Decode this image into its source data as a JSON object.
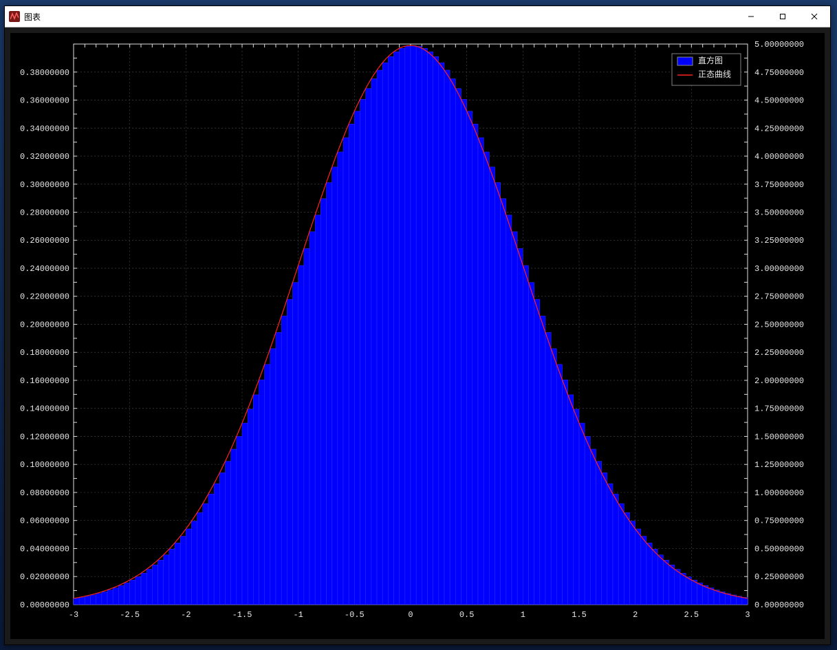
{
  "window": {
    "title": "图表",
    "controls": {
      "min": "—",
      "max": "☐",
      "close": "✕"
    }
  },
  "legend": {
    "items": [
      {
        "label": "直方图",
        "swatch": "#0000ff",
        "type": "box"
      },
      {
        "label": "正态曲线",
        "swatch": "#ff2020",
        "type": "line"
      }
    ]
  },
  "chart_data": {
    "type": "bar",
    "x_range": [
      -3,
      3
    ],
    "left_y_range": [
      0,
      0.4
    ],
    "right_y_range": [
      0,
      5.0
    ],
    "left_y_ticks": [
      0.0,
      0.02,
      0.04,
      0.06,
      0.08,
      0.1,
      0.12,
      0.14,
      0.16,
      0.18,
      0.2,
      0.22,
      0.24,
      0.26,
      0.28,
      0.3,
      0.32,
      0.34,
      0.36,
      0.38
    ],
    "right_y_ticks": [
      0.0,
      0.25,
      0.5,
      0.75,
      1.0,
      1.25,
      1.5,
      1.75,
      2.0,
      2.25,
      2.5,
      2.75,
      3.0,
      3.25,
      3.5,
      3.75,
      4.0,
      4.25,
      4.5,
      4.75,
      5.0
    ],
    "x_ticks_major": [
      -3,
      -2.5,
      -2,
      -1.5,
      -1,
      -0.5,
      0,
      0.5,
      1,
      1.5,
      2,
      2.5,
      3
    ],
    "series": [
      {
        "name": "直方图",
        "kind": "histogram",
        "axis": "left",
        "bin_width": 0.05,
        "x": [
          -3.0,
          -2.95,
          -2.9,
          -2.85,
          -2.8,
          -2.75,
          -2.7,
          -2.65,
          -2.6,
          -2.55,
          -2.5,
          -2.45,
          -2.4,
          -2.35,
          -2.3,
          -2.25,
          -2.2,
          -2.15,
          -2.1,
          -2.05,
          -2.0,
          -1.95,
          -1.9,
          -1.85,
          -1.8,
          -1.75,
          -1.7,
          -1.65,
          -1.6,
          -1.55,
          -1.5,
          -1.45,
          -1.4,
          -1.35,
          -1.3,
          -1.25,
          -1.2,
          -1.15,
          -1.1,
          -1.05,
          -1.0,
          -0.95,
          -0.9,
          -0.85,
          -0.8,
          -0.75,
          -0.7,
          -0.65,
          -0.6,
          -0.55,
          -0.5,
          -0.45,
          -0.4,
          -0.35,
          -0.3,
          -0.25,
          -0.2,
          -0.15,
          -0.1,
          -0.05,
          0.0,
          0.05,
          0.1,
          0.15,
          0.2,
          0.25,
          0.3,
          0.35,
          0.4,
          0.45,
          0.5,
          0.55,
          0.6,
          0.65,
          0.7,
          0.75,
          0.8,
          0.85,
          0.9,
          0.95,
          1.0,
          1.05,
          1.1,
          1.15,
          1.2,
          1.25,
          1.3,
          1.35,
          1.4,
          1.45,
          1.5,
          1.55,
          1.6,
          1.65,
          1.7,
          1.75,
          1.8,
          1.85,
          1.9,
          1.95,
          2.0,
          2.05,
          2.1,
          2.15,
          2.2,
          2.25,
          2.3,
          2.35,
          2.4,
          2.45,
          2.5,
          2.55,
          2.6,
          2.65,
          2.7,
          2.75,
          2.8,
          2.85,
          2.9,
          2.95
        ],
        "values": [
          0.004432,
          0.005143,
          0.005953,
          0.006873,
          0.007915,
          0.009094,
          0.010421,
          0.011912,
          0.013583,
          0.015449,
          0.017528,
          0.019837,
          0.022395,
          0.025218,
          0.028327,
          0.03174,
          0.035475,
          0.03955,
          0.043984,
          0.048792,
          0.053991,
          0.059595,
          0.065616,
          0.072065,
          0.07895,
          0.086277,
          0.094049,
          0.102265,
          0.110921,
          0.120009,
          0.129518,
          0.139431,
          0.149727,
          0.160383,
          0.171369,
          0.182649,
          0.194186,
          0.205936,
          0.217852,
          0.229882,
          0.241971,
          0.254059,
          0.266085,
          0.277985,
          0.289692,
          0.301137,
          0.312254,
          0.322972,
          0.333225,
          0.342944,
          0.352065,
          0.360527,
          0.36827,
          0.37524,
          0.381388,
          0.386668,
          0.391043,
          0.394479,
          0.396953,
          0.398444,
          0.398942,
          0.398444,
          0.396953,
          0.394479,
          0.391043,
          0.386668,
          0.381388,
          0.37524,
          0.36827,
          0.360527,
          0.352065,
          0.342944,
          0.333225,
          0.322972,
          0.312254,
          0.301137,
          0.289692,
          0.277985,
          0.266085,
          0.254059,
          0.241971,
          0.229882,
          0.217852,
          0.205936,
          0.194186,
          0.182649,
          0.171369,
          0.160383,
          0.149727,
          0.139431,
          0.129518,
          0.120009,
          0.110921,
          0.102265,
          0.094049,
          0.086277,
          0.07895,
          0.072065,
          0.065616,
          0.059595,
          0.053991,
          0.048792,
          0.043984,
          0.03955,
          0.035475,
          0.03174,
          0.028327,
          0.025218,
          0.022395,
          0.019837,
          0.017528,
          0.015449,
          0.013583,
          0.011912,
          0.010421,
          0.009094,
          0.007915,
          0.006873,
          0.005953,
          0.005143
        ]
      },
      {
        "name": "正态曲线",
        "kind": "line",
        "axis": "left",
        "mu": 0,
        "sigma": 1,
        "formula": "pdf(x) = 1/sqrt(2*pi) * exp(-x^2/2)"
      }
    ]
  }
}
